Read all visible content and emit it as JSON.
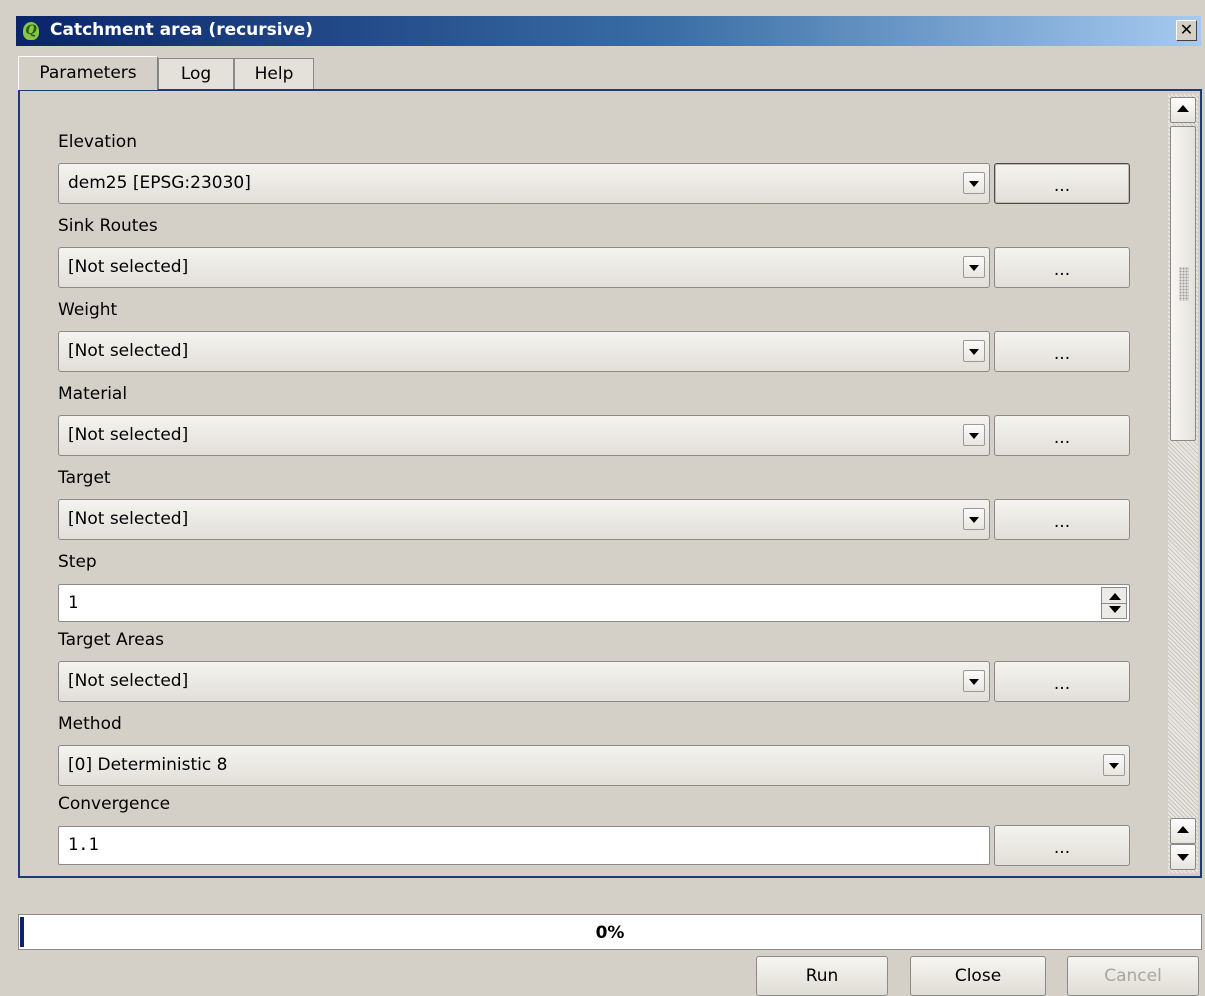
{
  "window": {
    "title": "Catchment area (recursive)",
    "close_glyph": "✕"
  },
  "tabs": [
    {
      "label": "Parameters",
      "active": true
    },
    {
      "label": "Log",
      "active": false
    },
    {
      "label": "Help",
      "active": false
    }
  ],
  "fields": {
    "elevation": {
      "label": "Elevation",
      "value": "dem25 [EPSG:23030]",
      "button": "..."
    },
    "sink_routes": {
      "label": "Sink Routes",
      "value": "[Not selected]",
      "button": "..."
    },
    "weight": {
      "label": "Weight",
      "value": "[Not selected]",
      "button": "..."
    },
    "material": {
      "label": "Material",
      "value": "[Not selected]",
      "button": "..."
    },
    "target": {
      "label": "Target",
      "value": "[Not selected]",
      "button": "..."
    },
    "step": {
      "label": "Step",
      "value": "1"
    },
    "target_areas": {
      "label": "Target Areas",
      "value": "[Not selected]",
      "button": "..."
    },
    "method": {
      "label": "Method",
      "value": "[0] Deterministic 8"
    },
    "convergence": {
      "label": "Convergence",
      "value": "1.1",
      "button": "..."
    }
  },
  "progress": {
    "value_percent": 0,
    "label": "0%",
    "color": "#0a246a"
  },
  "buttons": {
    "run": "Run",
    "close": "Close",
    "cancel": "Cancel"
  },
  "colors": {
    "titlebar_start": "#0a246a",
    "titlebar_end": "#a6caf0",
    "panel_border": "#1f3a7a",
    "background": "#d4d0c8"
  }
}
